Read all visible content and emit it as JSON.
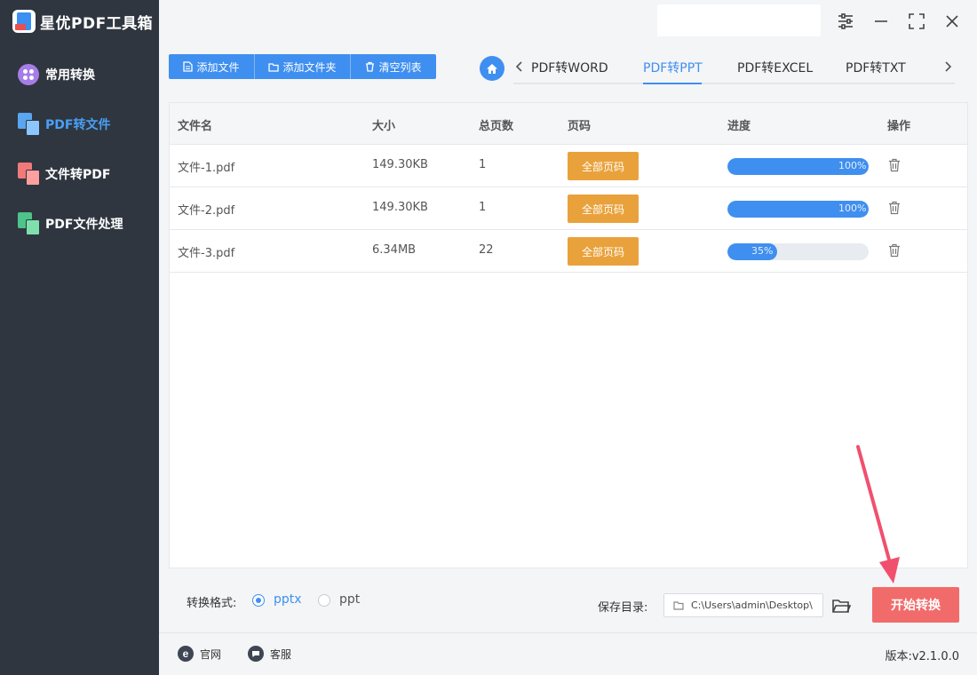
{
  "app": {
    "title": "星优PDF工具箱"
  },
  "sidebar": {
    "items": [
      {
        "label": "常用转换"
      },
      {
        "label": "PDF转文件"
      },
      {
        "label": "文件转PDF"
      },
      {
        "label": "PDF文件处理"
      }
    ]
  },
  "toolbar": {
    "add_file": "添加文件",
    "add_folder": "添加文件夹",
    "clear_list": "清空列表"
  },
  "tabs": [
    "PDF转WORD",
    "PDF转PPT",
    "PDF转EXCEL",
    "PDF转TXT"
  ],
  "active_tab": "PDF转PPT",
  "table": {
    "headers": [
      "文件名",
      "大小",
      "总页数",
      "页码",
      "进度",
      "操作"
    ],
    "rows": [
      {
        "name": "文件-1.pdf",
        "size": "149.30KB",
        "pages": "1",
        "page_button": "全部页码",
        "progress": 100,
        "progress_text": "100%"
      },
      {
        "name": "文件-2.pdf",
        "size": "149.30KB",
        "pages": "1",
        "page_button": "全部页码",
        "progress": 100,
        "progress_text": "100%"
      },
      {
        "name": "文件-3.pdf",
        "size": "6.34MB",
        "pages": "22",
        "page_button": "全部页码",
        "progress": 35,
        "progress_text": "35%"
      }
    ]
  },
  "bottom": {
    "format_label": "转换格式:",
    "formats": [
      {
        "label": "pptx",
        "checked": true
      },
      {
        "label": "ppt",
        "checked": false
      }
    ],
    "save_label": "保存目录:",
    "save_path": "C:\\Users\\admin\\Desktop\\",
    "start_button": "开始转换"
  },
  "footer": {
    "website": "官网",
    "service": "客服",
    "version": "版本:v2.1.0.0"
  },
  "colors": {
    "sidebar_bg": "#2f3640",
    "accent": "#3f8ff0",
    "page_button": "#e9a23b",
    "start_button": "#f26b6b"
  }
}
